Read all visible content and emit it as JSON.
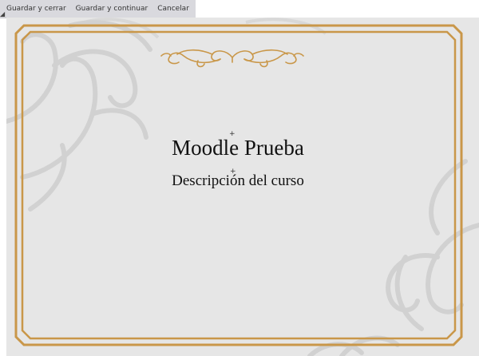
{
  "toolbar": {
    "save_close_label": "Guardar y cerrar",
    "save_continue_label": "Guardar y continuar",
    "cancel_label": "Cancelar"
  },
  "certificate": {
    "title": "Moodle Prueba",
    "description": "Descripción del curso",
    "colors": {
      "border": "#c99749",
      "background": "#e6e6e6",
      "ornament": "#c9c9c9"
    }
  }
}
